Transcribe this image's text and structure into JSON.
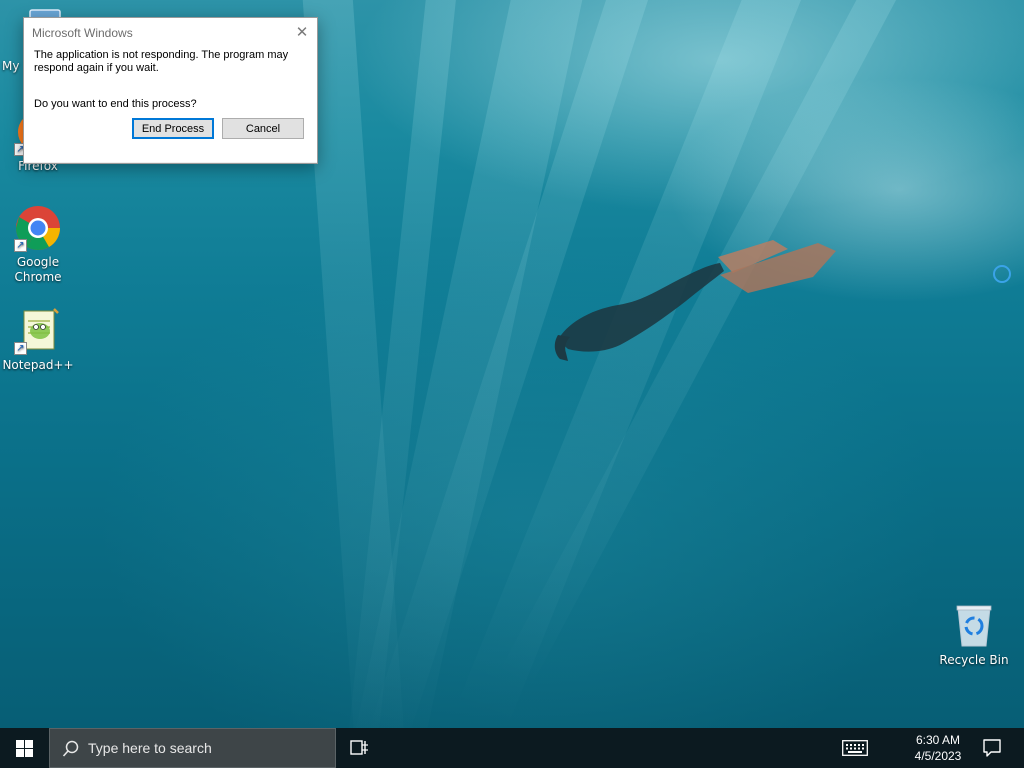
{
  "desktop": {
    "icons": [
      {
        "label": "My"
      },
      {
        "label": "Firefox"
      },
      {
        "label": "Google Chrome"
      },
      {
        "label": "Notepad++"
      },
      {
        "label": "Recycle Bin"
      }
    ]
  },
  "dialog": {
    "title": "Microsoft Windows",
    "message": "The application is not responding. The program may respond again if you wait.",
    "question": "Do you want to end this process?",
    "buttons": {
      "end_process": "End Process",
      "cancel": "Cancel"
    }
  },
  "taskbar": {
    "search_placeholder": "Type here to search",
    "time": "6:30 AM",
    "date": "4/5/2023"
  },
  "colors": {
    "taskbar_bg": "#0c1a20",
    "dialog_accent": "#0078d7",
    "start_icon": "#ffffff"
  },
  "icons": {
    "start": "windows-logo-icon",
    "search": "search-icon",
    "task_view": "task-view-icon",
    "keyboard": "touch-keyboard-icon",
    "notifications": "action-center-icon"
  }
}
